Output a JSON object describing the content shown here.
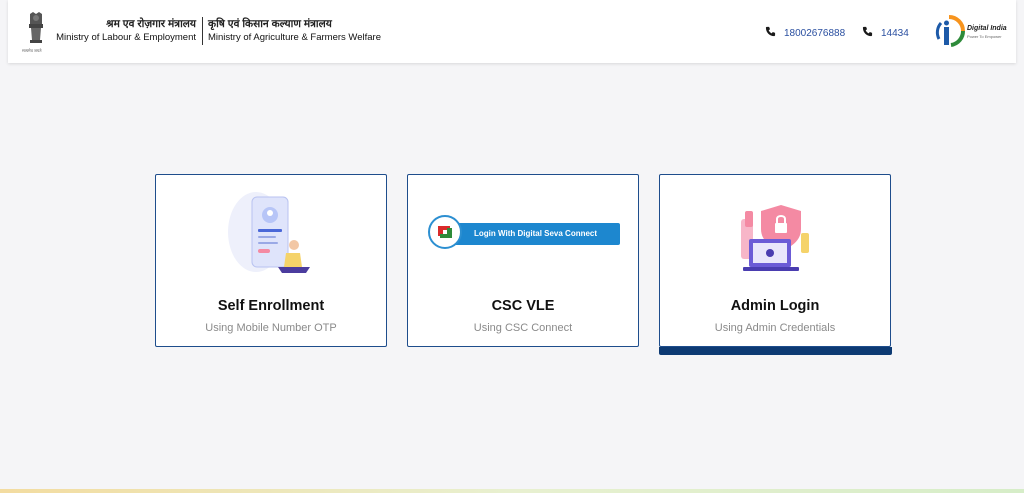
{
  "header": {
    "emblem_icon": "national-emblem-icon",
    "emblem_caption": "सत्यमेव जयते",
    "ministry_labour": {
      "hindi": "श्रम एव रोज़गार मंत्रालय",
      "english": "Ministry of Labour & Employment"
    },
    "ministry_agri": {
      "hindi": "कृषि एवं किसान कल्याण मंत्रालय",
      "english": "Ministry of Agriculture & Farmers Welfare"
    },
    "phones": [
      {
        "icon": "phone-icon",
        "number": "18002676888"
      },
      {
        "icon": "phone-icon",
        "number": "14434"
      }
    ],
    "digital_india": {
      "icon": "digital-india-logo",
      "title": "Digital India",
      "tagline": "Power To Empower"
    }
  },
  "cards": [
    {
      "title": "Self Enrollment",
      "subtitle": "Using Mobile Number OTP",
      "icon": "mobile-enrollment-illustration",
      "active": false
    },
    {
      "title": "CSC VLE",
      "subtitle": "Using CSC Connect",
      "icon": "csc-connect-banner",
      "banner_text": "Login With Digital Seva Connect",
      "active": false
    },
    {
      "title": "Admin Login",
      "subtitle": "Using Admin Credentials",
      "icon": "admin-security-illustration",
      "active": true
    }
  ],
  "colors": {
    "accent": "#0d3a73",
    "card_border": "#1e4d8c",
    "background": "#f5f5f7",
    "link": "#2a4fa0",
    "csc_blue": "#1d87cf"
  }
}
